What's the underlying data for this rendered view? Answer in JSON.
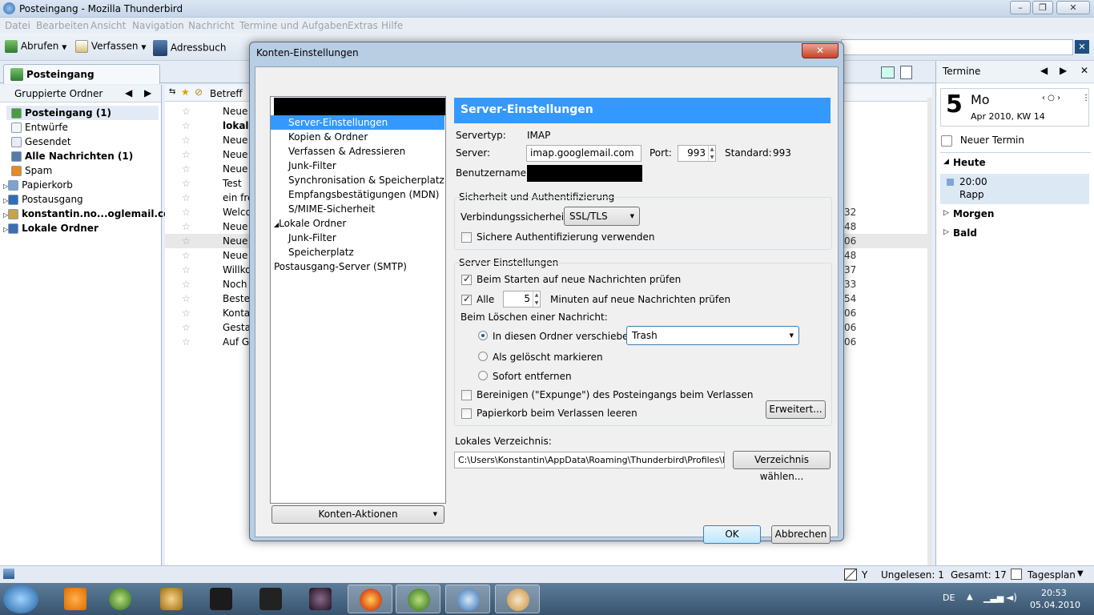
{
  "app": {
    "window_title": "Posteingang - Mozilla Thunderbird"
  },
  "menu": [
    "Datei",
    "Bearbeiten",
    "Ansicht",
    "Navigation",
    "Nachricht",
    "Termine und Aufgaben",
    "Extras",
    "Hilfe"
  ],
  "toolbar": {
    "get_mail": "Abrufen",
    "compose": "Verfassen",
    "address_book": "Adressbuch"
  },
  "tabs": {
    "inbox": "Posteingang"
  },
  "folder_pane": {
    "header": "Gruppierte Ordner",
    "folders": [
      {
        "label": "Posteingang (1)",
        "bold": true
      },
      {
        "label": "Entwürfe",
        "bold": false
      },
      {
        "label": "Gesendet",
        "bold": false
      },
      {
        "label": "Alle Nachrichten (1)",
        "bold": true
      },
      {
        "label": "Spam",
        "bold": false
      },
      {
        "label": "Papierkorb",
        "bold": false
      },
      {
        "label": "Postausgang",
        "bold": false
      },
      {
        "label": "konstantin.no...oglemail.com",
        "bold": true
      },
      {
        "label": "Lokale Ordner",
        "bold": true
      }
    ]
  },
  "message_list": {
    "column_subject": "Betreff",
    "rows": [
      {
        "subject": "Neue",
        "num": ""
      },
      {
        "subject": "lokalis",
        "num": ""
      },
      {
        "subject": "Neue",
        "num": ""
      },
      {
        "subject": "Neue",
        "num": ""
      },
      {
        "subject": "Neue",
        "num": ""
      },
      {
        "subject": "Test",
        "num": ""
      },
      {
        "subject": "ein fre",
        "num": ""
      },
      {
        "subject": "Welco",
        "num": "32"
      },
      {
        "subject": "Neue",
        "num": "48"
      },
      {
        "subject": "Neue",
        "num": "06"
      },
      {
        "subject": "Neue",
        "num": "48"
      },
      {
        "subject": "Willko",
        "num": "37"
      },
      {
        "subject": "Noch",
        "num": "33"
      },
      {
        "subject": "Bestell",
        "num": "54"
      },
      {
        "subject": "Kontal",
        "num": "06"
      },
      {
        "subject": "Gestal",
        "num": "06"
      },
      {
        "subject": "Auf Go",
        "num": "06"
      }
    ]
  },
  "calendar": {
    "header": "Termine",
    "day_number": "5",
    "day_name": "Mo",
    "month_week": "Apr 2010, KW 14",
    "new_event": "Neuer Termin",
    "today": "Heute",
    "event_time": "20:00",
    "event_title": "Rapp",
    "tomorrow": "Morgen",
    "soon": "Bald"
  },
  "statusbar": {
    "unread": "Ungelesen: 1",
    "total": "Gesamt: 17",
    "day_plan": "Tagesplan",
    "y_label": "Y"
  },
  "taskbar": {
    "lang": "DE",
    "time": "20:53",
    "date": "05.04.2010"
  },
  "dialog": {
    "title": "Konten-Einstellungen",
    "tree": [
      {
        "label": "Server-Einstellungen",
        "selected": true,
        "indent": 1
      },
      {
        "label": "Kopien & Ordner",
        "selected": false,
        "indent": 1
      },
      {
        "label": "Verfassen & Adressieren",
        "selected": false,
        "indent": 1
      },
      {
        "label": "Junk-Filter",
        "selected": false,
        "indent": 1
      },
      {
        "label": "Synchronisation & Speicherplatz",
        "selected": false,
        "indent": 1
      },
      {
        "label": "Empfangsbestätigungen (MDN)",
        "selected": false,
        "indent": 1
      },
      {
        "label": "S/MIME-Sicherheit",
        "selected": false,
        "indent": 1
      },
      {
        "label": "Lokale Ordner",
        "selected": false,
        "indent": 0
      },
      {
        "label": "Junk-Filter",
        "selected": false,
        "indent": 1
      },
      {
        "label": "Speicherplatz",
        "selected": false,
        "indent": 1
      },
      {
        "label": "Postausgang-Server (SMTP)",
        "selected": false,
        "indent": 0
      }
    ],
    "account_actions": "Konten-Aktionen",
    "section_title": "Server-Einstellungen",
    "server_type_label": "Servertyp:",
    "server_type_value": "IMAP",
    "server_label": "Server:",
    "server_value": "imap.googlemail.com",
    "port_label": "Port:",
    "port_value": "993",
    "standard_label": "Standard:",
    "standard_value": "993",
    "username_label": "Benutzername:",
    "security_group": "Sicherheit und Authentifizierung",
    "conn_security_label": "Verbindungssicherheit:",
    "conn_security_value": "SSL/TLS",
    "secure_auth_label": "Sichere Authentifizierung verwenden",
    "server_group": "Server-Einstellungen",
    "check_on_start": "Beim Starten auf neue Nachrichten prüfen",
    "every_label": "Alle",
    "every_value": "5",
    "minutes_label": "Minuten auf neue Nachrichten prüfen",
    "on_delete_label": "Beim Löschen einer Nachricht:",
    "move_to_folder": "In diesen Ordner verschieben:",
    "trash_folder": "Trash",
    "mark_deleted": "Als gelöscht markieren",
    "remove_immediately": "Sofort entfernen",
    "expunge_label": "Bereinigen (\"Expunge\") des Posteingangs beim Verlassen",
    "empty_trash_label": "Papierkorb beim Verlassen leeren",
    "advanced_button": "Erweitert...",
    "local_dir_label": "Lokales Verzeichnis:",
    "local_dir_value": "C:\\Users\\Konstantin\\AppData\\Roaming\\Thunderbird\\Profiles\\l",
    "choose_dir_button": "Verzeichnis wählen...",
    "ok_button": "OK",
    "cancel_button": "Abbrechen",
    "checked": {
      "secure_auth": false,
      "check_on_start": true,
      "every": true,
      "expunge": false,
      "empty_trash": false
    },
    "delete_mode": "move"
  },
  "colors": {
    "accent": "#3399ff",
    "selection": "#3399ff",
    "redacted": "#000000"
  }
}
